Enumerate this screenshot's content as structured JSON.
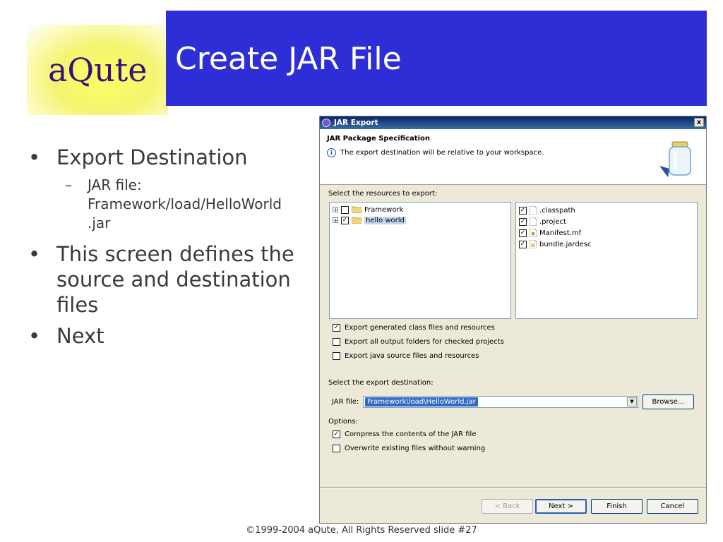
{
  "slide": {
    "logo": "aQute",
    "title": "Create JAR File",
    "bullets": [
      "Export Destination",
      "This screen defines the source and destination files",
      "Next"
    ],
    "sub_bullet_line1": "JAR file:",
    "sub_bullet_line2": "Framework/load/HelloWorld",
    "sub_bullet_line3": ".jar",
    "footer": "©1999-2004 aQute, All Rights Reserved  slide #27"
  },
  "dialog": {
    "title": "JAR Export",
    "close": "x",
    "header_title": "JAR Package Specification",
    "header_info": "The export destination will be relative to your workspace.",
    "resources_label": "Select the resources to export:",
    "tree": [
      {
        "label": "Framework",
        "checked": false
      },
      {
        "label": "hello world",
        "checked": true
      }
    ],
    "files": [
      {
        "label": ".classpath",
        "checked": true
      },
      {
        "label": ".project",
        "checked": true
      },
      {
        "label": "Manifest.mf",
        "checked": true
      },
      {
        "label": "bundle.jardesc",
        "checked": true
      }
    ],
    "export_options": [
      {
        "label": "Export generated class files and resources",
        "checked": true
      },
      {
        "label": "Export all output folders for checked projects",
        "checked": false
      },
      {
        "label": "Export java source files and resources",
        "checked": false
      }
    ],
    "destination_label": "Select the export destination:",
    "jar_file_label": "JAR file:",
    "jar_file_value": "Framework\\load\\HelloWorld.jar",
    "browse_label": "Browse...",
    "options_label": "Options:",
    "options": [
      {
        "label": "Compress the contents of the JAR file",
        "checked": true
      },
      {
        "label": "Overwrite existing files without warning",
        "checked": false
      }
    ],
    "buttons": {
      "back": "< Back",
      "next": "Next >",
      "finish": "Finish",
      "cancel": "Cancel"
    }
  }
}
